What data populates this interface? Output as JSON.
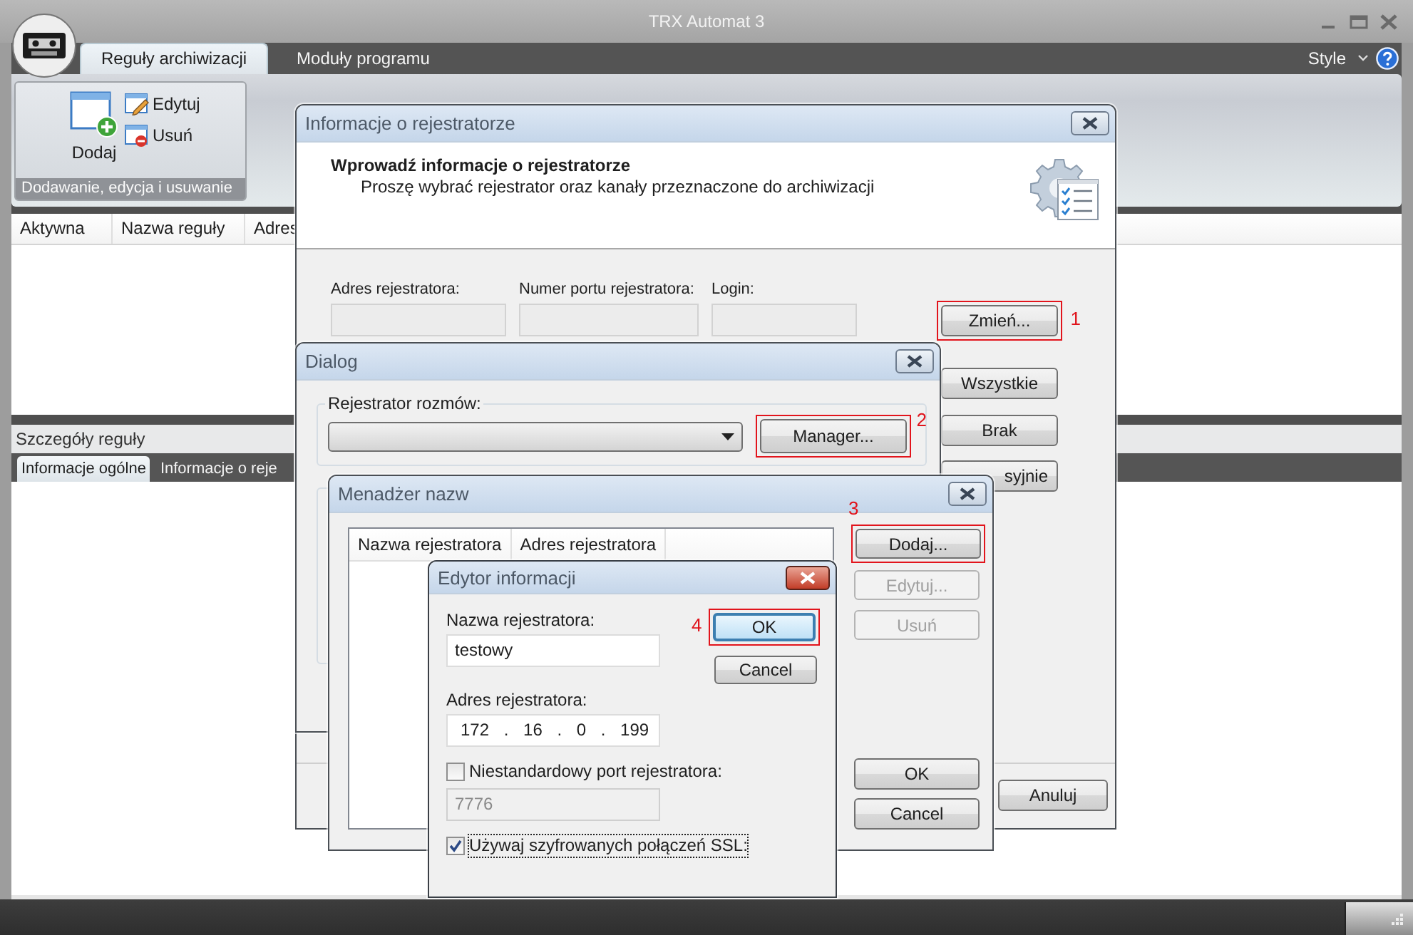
{
  "window": {
    "title": "TRX Automat 3"
  },
  "ribbon": {
    "tabs": [
      {
        "label": "Reguły archiwizacji",
        "selected": true
      },
      {
        "label": "Moduły programu",
        "selected": false
      }
    ],
    "style_menu": "Style",
    "group": {
      "label": "Dodawanie, edycja i usuwanie",
      "buttons": [
        {
          "label": "Dodaj",
          "kind": "large"
        },
        {
          "label": "Edytuj",
          "kind": "small"
        },
        {
          "label": "Usuń",
          "kind": "small"
        }
      ]
    }
  },
  "rules_table": {
    "columns": [
      "Aktywna",
      "Nazwa reguły",
      "Adres"
    ]
  },
  "details": {
    "title": "Szczegóły reguły",
    "tabs": [
      {
        "label": "Informacje ogólne",
        "selected": true
      },
      {
        "label": "Informacje o reje",
        "selected": false
      }
    ]
  },
  "recorder_dialog": {
    "title": "Informacje o rejestratorze",
    "heading": "Wprowadź informacje o rejestratorze",
    "subheading": "Proszę wybrać rejestrator oraz kanały przeznaczone do archiwizacji",
    "fields": [
      {
        "label": "Adres rejestratora:"
      },
      {
        "label": "Numer portu rejestratora:"
      },
      {
        "label": "Login:"
      }
    ],
    "side_buttons": [
      {
        "label": "Zmień...",
        "highlighted": true,
        "marker": "1"
      },
      {
        "label": "Wszystkie",
        "highlighted": false
      },
      {
        "label": "Brak",
        "highlighted": false
      },
      {
        "label": "syjnie",
        "highlighted": false
      }
    ],
    "footer_buttons": [
      "Anuluj"
    ]
  },
  "selector_dialog": {
    "title": "Dialog",
    "group_label": "Rejestrator rozmów:",
    "button": {
      "label": "Manager...",
      "highlighted": true,
      "marker": "2"
    }
  },
  "name_manager": {
    "title": "Menadżer nazw",
    "columns": [
      "Nazwa rejestratora",
      "Adres rejestratora"
    ],
    "buttons": [
      {
        "label": "Dodaj...",
        "disabled": false,
        "highlighted": true,
        "marker": "3"
      },
      {
        "label": "Edytuj...",
        "disabled": true,
        "highlighted": false
      },
      {
        "label": "Usuń",
        "disabled": true,
        "highlighted": false
      }
    ],
    "footer_buttons": [
      "OK",
      "Cancel"
    ]
  },
  "info_editor": {
    "title": "Edytor informacji",
    "name_label": "Nazwa rejestratora:",
    "name_value": "testowy",
    "address_label": "Adres rejestratora:",
    "address_value": "172 . 16 . 0 . 199",
    "port_checkbox": {
      "label": "Niestandardowy port rejestratora:",
      "checked": false
    },
    "port_value": "7776",
    "ssl_checkbox": {
      "label": "Używaj szyfrowanych połączeń SSL:",
      "checked": true,
      "focused": true
    },
    "buttons": [
      {
        "label": "OK",
        "highlighted": true,
        "marker": "4",
        "default": true
      },
      {
        "label": "Cancel",
        "highlighted": false,
        "default": false
      }
    ]
  }
}
